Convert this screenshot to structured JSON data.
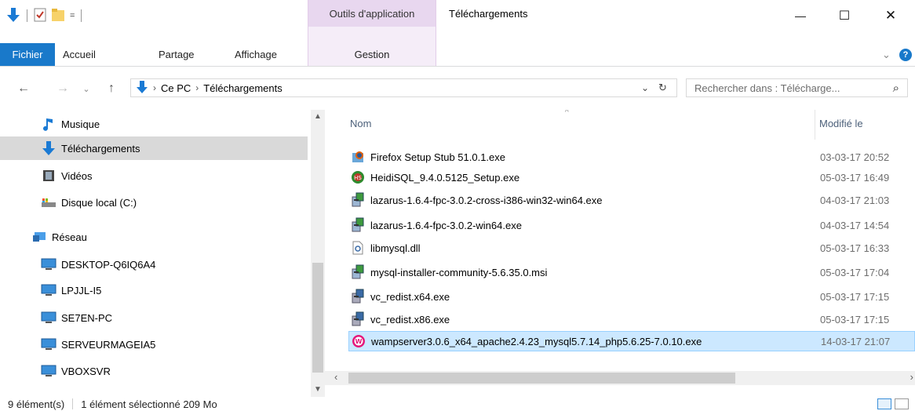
{
  "titlebar": {
    "context_tab_header": "Outils d'application",
    "context_tab_label": "Gestion",
    "window_title": "Téléchargements",
    "minimize": "—",
    "maximize": "☐",
    "close": "✕"
  },
  "ribbon": {
    "tabs": [
      "Fichier",
      "Accueil",
      "Partage",
      "Affichage"
    ],
    "collapse": "⌄",
    "help": "?"
  },
  "address": {
    "crumbs": [
      "Ce PC",
      "Téléchargements"
    ],
    "search_placeholder": "Rechercher dans : Télécharge...",
    "search_icon": "⌕"
  },
  "navpane": {
    "items": [
      {
        "label": "Musique",
        "icon": "music-icon"
      },
      {
        "label": "Téléchargements",
        "icon": "download-icon",
        "selected": true
      },
      {
        "label": "Vidéos",
        "icon": "video-icon"
      },
      {
        "label": "Disque local (C:)",
        "icon": "drive-icon"
      },
      {
        "label": "Réseau",
        "icon": "network-icon"
      },
      {
        "label": "DESKTOP-Q6IQ6A4",
        "icon": "computer-icon"
      },
      {
        "label": "LPJJL-I5",
        "icon": "computer-icon"
      },
      {
        "label": "SE7EN-PC",
        "icon": "computer-icon"
      },
      {
        "label": "SERVEURMAGEIA5",
        "icon": "computer-icon"
      },
      {
        "label": "VBOXSVR",
        "icon": "computer-icon"
      }
    ]
  },
  "filelist": {
    "col_name": "Nom",
    "col_modified": "Modifié le",
    "files": [
      {
        "name": "Firefox Setup Stub 51.0.1.exe",
        "date": "03-03-17 20:52",
        "icon": "firefox-installer-icon"
      },
      {
        "name": "HeidiSQL_9.4.0.5125_Setup.exe",
        "date": "05-03-17 16:49",
        "icon": "heidisql-icon"
      },
      {
        "name": "lazarus-1.6.4-fpc-3.0.2-cross-i386-win32-win64.exe",
        "date": "04-03-17 21:03",
        "icon": "installer-icon"
      },
      {
        "name": "lazarus-1.6.4-fpc-3.0.2-win64.exe",
        "date": "04-03-17 14:54",
        "icon": "installer-icon"
      },
      {
        "name": "libmysql.dll",
        "date": "05-03-17 16:33",
        "icon": "dll-icon"
      },
      {
        "name": "mysql-installer-community-5.6.35.0.msi",
        "date": "05-03-17 17:04",
        "icon": "installer-icon"
      },
      {
        "name": "vc_redist.x64.exe",
        "date": "05-03-17 17:15",
        "icon": "installer-icon"
      },
      {
        "name": "vc_redist.x86.exe",
        "date": "05-03-17 17:15",
        "icon": "installer-icon"
      },
      {
        "name": "wampserver3.0.6_x64_apache2.4.23_mysql5.7.14_php5.6.25-7.0.10.exe",
        "date": "14-03-17 21:07",
        "icon": "wampserver-icon",
        "selected": true
      }
    ]
  },
  "status": {
    "count": "9 élément(s)",
    "selection": "1 élément sélectionné  209 Mo"
  },
  "colors": {
    "accent": "#1979ca",
    "selection_bg": "#cce8ff",
    "context_tab": "#e8d7ef"
  }
}
